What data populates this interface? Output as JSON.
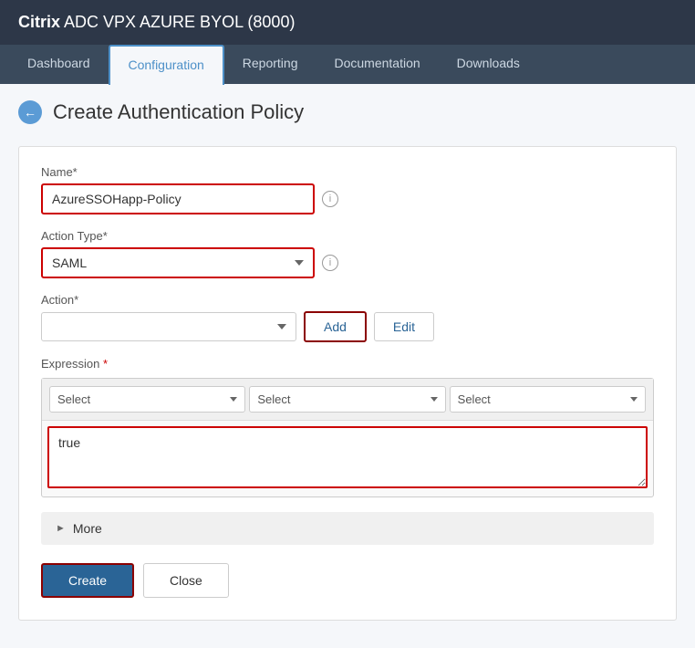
{
  "header": {
    "brand_bold": "Citrix",
    "brand_rest": " ADC VPX AZURE BYOL (8000)"
  },
  "nav": {
    "tabs": [
      {
        "id": "dashboard",
        "label": "Dashboard",
        "active": false
      },
      {
        "id": "configuration",
        "label": "Configuration",
        "active": true
      },
      {
        "id": "reporting",
        "label": "Reporting",
        "active": false
      },
      {
        "id": "documentation",
        "label": "Documentation",
        "active": false
      },
      {
        "id": "downloads",
        "label": "Downloads",
        "active": false
      }
    ]
  },
  "page": {
    "title": "Create Authentication Policy"
  },
  "form": {
    "name_label": "Name*",
    "name_value": "AzureSSOHapp-Policy",
    "action_type_label": "Action Type*",
    "action_type_value": "SAML",
    "action_label": "Action*",
    "action_value": "",
    "add_button": "Add",
    "edit_button": "Edit",
    "expression_label": "Expression",
    "expression_select1": "Select",
    "expression_select2": "Select",
    "expression_select3": "Select",
    "expression_value": "true",
    "more_label": "More",
    "create_button": "Create",
    "close_button": "Close"
  }
}
